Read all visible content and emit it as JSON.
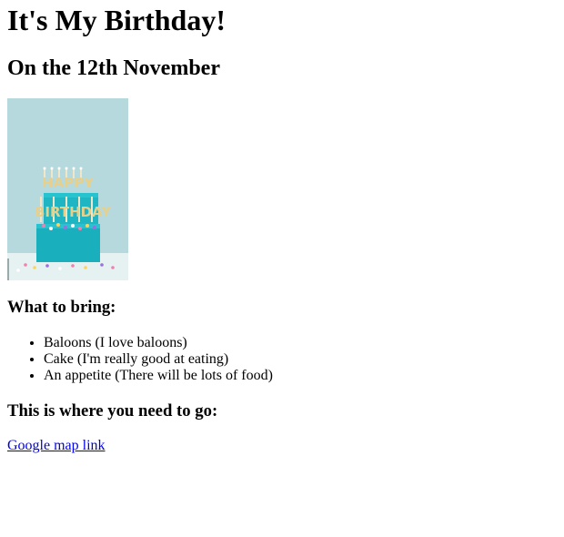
{
  "page": {
    "title": "It's My Birthday!",
    "subtitle": "On the 12th November"
  },
  "image": {
    "name": "birthday-cake-image",
    "text": "HAPPY BIRTHDAY",
    "background_color": "#b3d8dc",
    "cake_color": "#1fb5c3"
  },
  "bring": {
    "heading": "What to bring:",
    "items": [
      "Baloons (I love baloons)",
      "Cake (I'm really good at eating)",
      "An appetite (There will be lots of food)"
    ]
  },
  "directions": {
    "heading": "This is where you need to go:",
    "link_text": "Google map link"
  },
  "colors": {
    "link": "#0000ee",
    "text": "#000000"
  }
}
